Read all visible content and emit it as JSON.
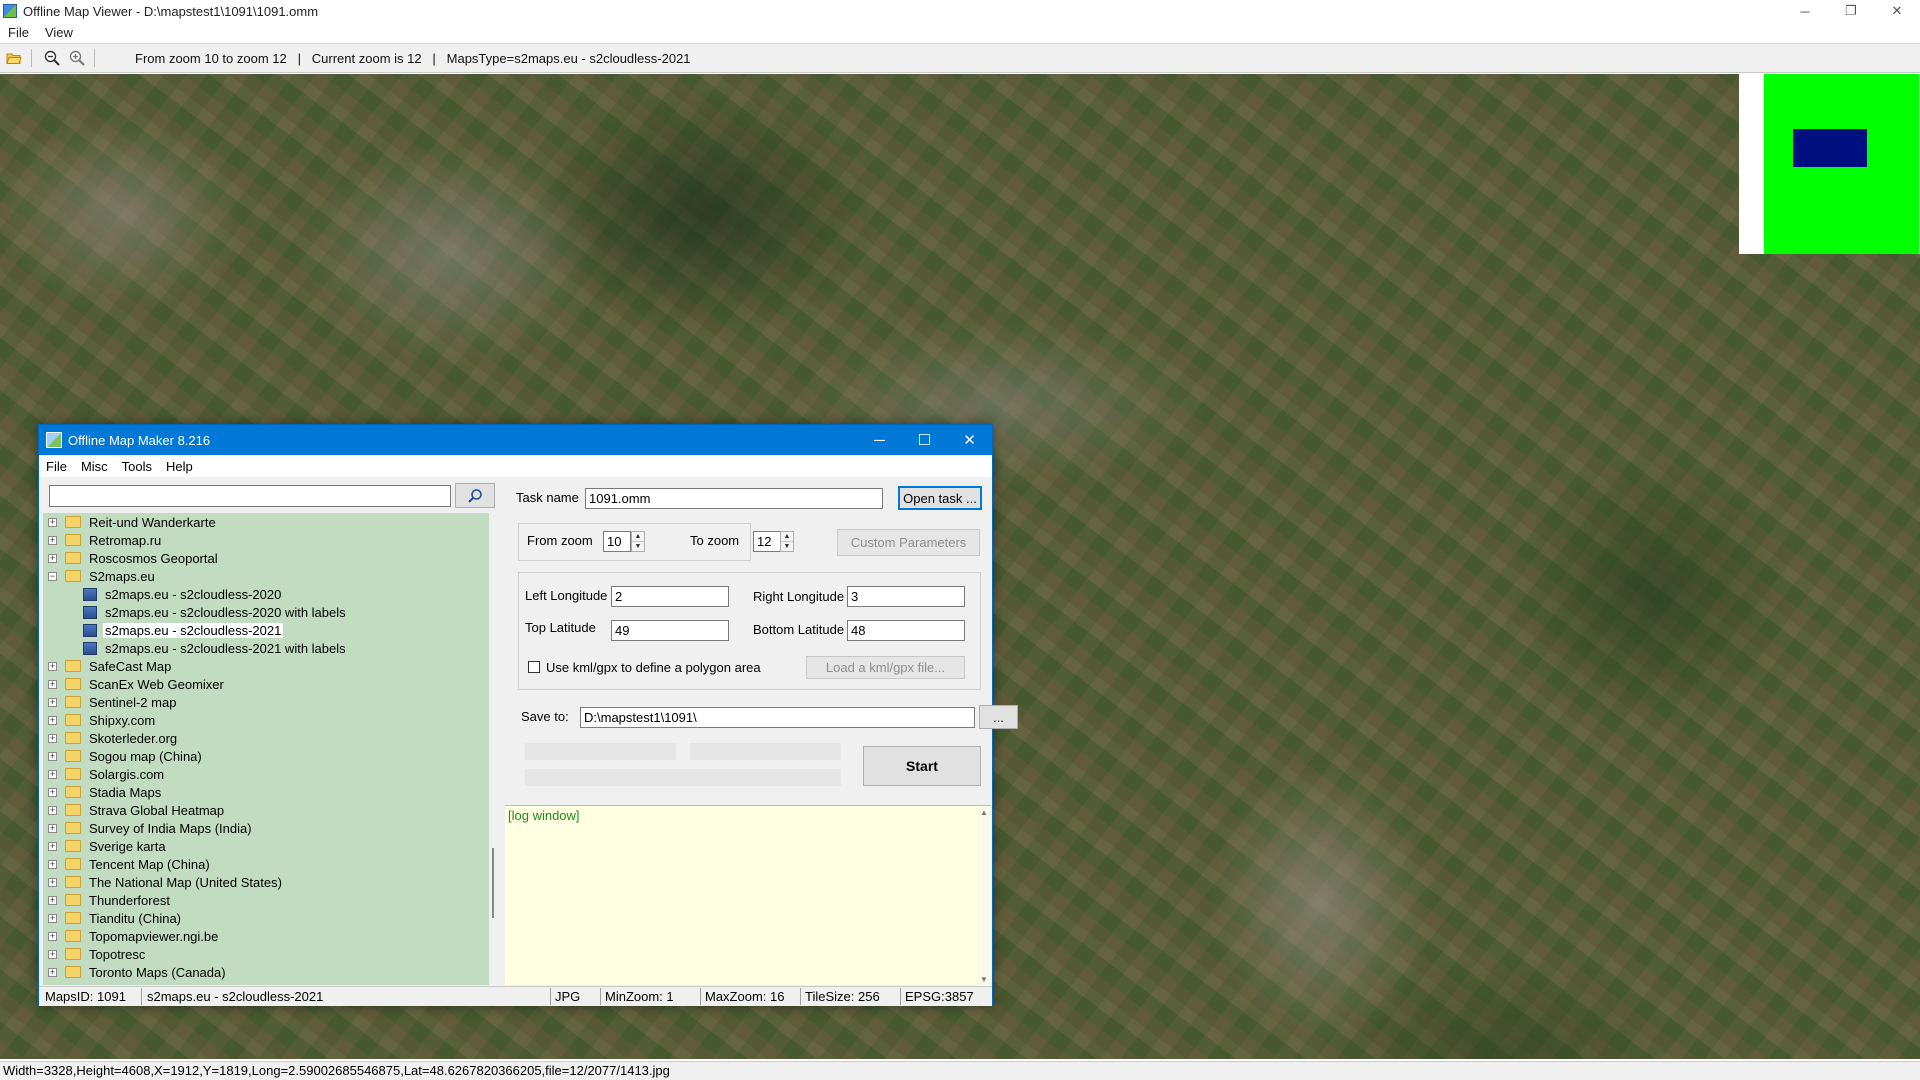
{
  "window": {
    "title": "Offline Map Viewer - D:\\mapstest1\\1091\\1091.omm",
    "controls": {
      "minimize": "─",
      "restore": "❐",
      "close": "✕"
    }
  },
  "menu": {
    "file": "File",
    "view": "View"
  },
  "toolbar": {
    "info": "From zoom 10 to zoom 12   |   Current zoom is 12   |   MapsType=s2maps.eu - s2cloudless-2021"
  },
  "status_bar": {
    "text": "Width=3328,Height=4608,X=1912,Y=1819,Long=2.59002685546875,Lat=48.6267820366205,file=12/2077/1413.jpg"
  },
  "dialog": {
    "title": "Offline Map Maker 8.216",
    "controls": {
      "minimize": "─",
      "maximize": "☐",
      "close": "✕"
    },
    "menu": {
      "file": "File",
      "misc": "Misc",
      "tools": "Tools",
      "help": "Help"
    },
    "search": {
      "value": ""
    },
    "tree": [
      {
        "label": "Reit-und Wanderkarte",
        "level": 0,
        "expander": "+"
      },
      {
        "label": "Retromap.ru",
        "level": 0,
        "expander": "+"
      },
      {
        "label": "Roscosmos Geoportal",
        "level": 0,
        "expander": "+"
      },
      {
        "label": "S2maps.eu",
        "level": 0,
        "expander": "−"
      },
      {
        "label": "s2maps.eu - s2cloudless-2020",
        "level": 1
      },
      {
        "label": "s2maps.eu - s2cloudless-2020 with labels",
        "level": 1
      },
      {
        "label": "s2maps.eu - s2cloudless-2021",
        "level": 1,
        "selected": true
      },
      {
        "label": "s2maps.eu - s2cloudless-2021 with labels",
        "level": 1
      },
      {
        "label": "SafeCast Map",
        "level": 0,
        "expander": "+"
      },
      {
        "label": "ScanEx Web Geomixer",
        "level": 0,
        "expander": "+"
      },
      {
        "label": "Sentinel-2 map",
        "level": 0,
        "expander": "+"
      },
      {
        "label": "Shipxy.com",
        "level": 0,
        "expander": "+"
      },
      {
        "label": "Skoterleder.org",
        "level": 0,
        "expander": "+"
      },
      {
        "label": "Sogou map (China)",
        "level": 0,
        "expander": "+"
      },
      {
        "label": "Solargis.com",
        "level": 0,
        "expander": "+"
      },
      {
        "label": "Stadia Maps",
        "level": 0,
        "expander": "+"
      },
      {
        "label": "Strava Global Heatmap",
        "level": 0,
        "expander": "+"
      },
      {
        "label": "Survey of India Maps (India)",
        "level": 0,
        "expander": "+"
      },
      {
        "label": "Sverige karta",
        "level": 0,
        "expander": "+"
      },
      {
        "label": "Tencent Map (China)",
        "level": 0,
        "expander": "+"
      },
      {
        "label": "The National Map (United States)",
        "level": 0,
        "expander": "+"
      },
      {
        "label": "Thunderforest",
        "level": 0,
        "expander": "+"
      },
      {
        "label": "Tianditu (China)",
        "level": 0,
        "expander": "+"
      },
      {
        "label": "Topomapviewer.ngi.be",
        "level": 0,
        "expander": "+"
      },
      {
        "label": "Topotresc",
        "level": 0,
        "expander": "+"
      },
      {
        "label": "Toronto Maps (Canada)",
        "level": 0,
        "expander": "+"
      }
    ],
    "task": {
      "label": "Task name",
      "value": "1091.omm",
      "open_button": "Open task ..."
    },
    "zoom": {
      "from_label": "From zoom",
      "from_value": "10",
      "to_label": "To zoom",
      "to_value": "12",
      "custom_button": "Custom Parameters"
    },
    "area": {
      "left_lon_label": "Left Longitude",
      "left_lon_value": "2",
      "right_lon_label": "Right Longitude",
      "right_lon_value": "3",
      "top_lat_label": "Top Latitude",
      "top_lat_value": "49",
      "bottom_lat_label": "Bottom Latitude",
      "bottom_lat_value": "48",
      "kml_checkbox_label": "Use kml/gpx to define a polygon area",
      "kml_button": "Load a kml/gpx file..."
    },
    "save": {
      "label": "Save to:",
      "value": "D:\\mapstest1\\1091\\",
      "browse_button": "..."
    },
    "start_button": "Start",
    "log": {
      "text": "[log window]"
    },
    "status": {
      "maps_id": "MapsID: 1091",
      "maps_name": "s2maps.eu - s2cloudless-2021",
      "format": "JPG",
      "min_zoom": "MinZoom: 1",
      "max_zoom": "MaxZoom: 16",
      "tile_size": "TileSize: 256",
      "epsg": "EPSG:3857"
    }
  },
  "colors": {
    "dialog_title_bg": "#0078d7",
    "tree_bg": "#c2dcc2",
    "log_bg": "#ffffe1",
    "log_text": "#228b22",
    "minimap_green": "#00ff00",
    "minimap_blue": "#000f80"
  }
}
